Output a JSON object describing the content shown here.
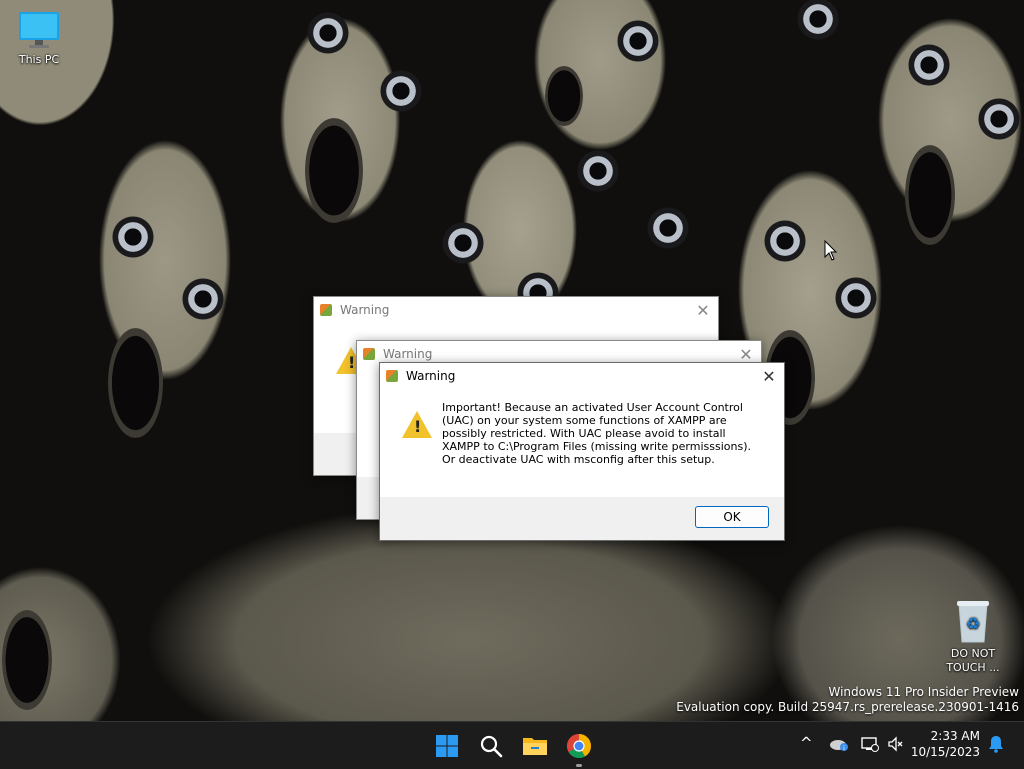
{
  "desktop": {
    "icons": [
      {
        "label": "This PC",
        "icon": "monitor-icon"
      },
      {
        "label": "DO NOT TOUCH ...",
        "icon": "recycle-bin-icon"
      }
    ],
    "watermark": {
      "line1": "Windows 11 Pro Insider Preview",
      "line2": "Evaluation copy. Build 25947.rs_prerelease.230901-1416"
    }
  },
  "dialogs": [
    {
      "title": "Warning",
      "state": "background"
    },
    {
      "title": "Warning",
      "state": "background"
    },
    {
      "title": "Warning",
      "state": "active",
      "message": "Important! Because an activated User Account Control (UAC) on your system some functions of XAMPP are possibly restricted. With UAC please avoid to install XAMPP to C:\\Program Files (missing write permisssions). Or deactivate UAC with msconfig after this setup.",
      "ok_label": "OK",
      "close_glyph": "✕"
    }
  ],
  "taskbar": {
    "apps": [
      "start-icon",
      "search-icon",
      "file-explorer-icon",
      "chrome-icon"
    ],
    "tray": {
      "chevron": "^",
      "time": "2:33 AM",
      "date": "10/15/2023"
    }
  },
  "colors": {
    "accent": "#0067c0",
    "taskbar": "#1c1c1c",
    "warning": "#f2c22b"
  }
}
